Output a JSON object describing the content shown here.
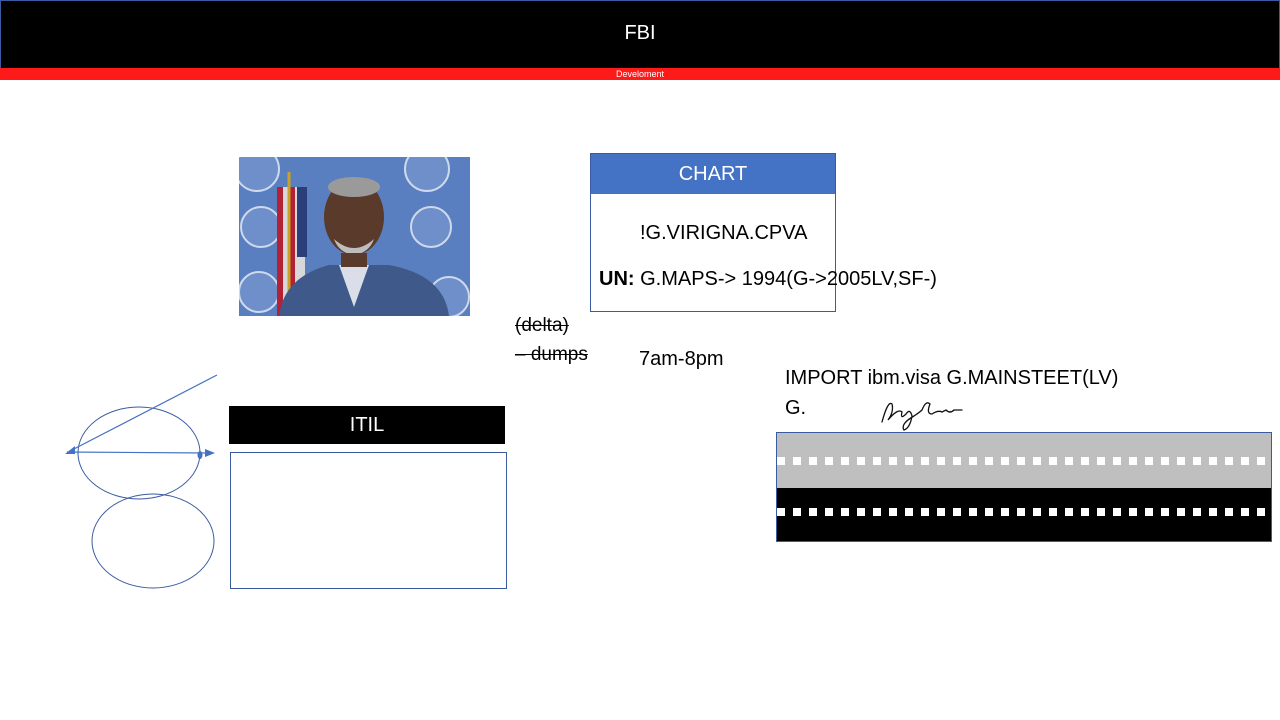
{
  "header": {
    "title": "FBI",
    "subtitle": "Develoment",
    "bar_color": "#ff1a1a",
    "background": "#000000"
  },
  "photo": {
    "icon": "portrait-photo"
  },
  "chart_box": {
    "title": "CHART",
    "line1": "!G.VIRIGNA.CPVA",
    "line2_prefix": "UN:",
    "line2_text": " G.MAPS-> 1994(G->2005LV,SF-)",
    "header_color": "#4472c4"
  },
  "notes": {
    "delta": "(delta)",
    "dumps": "– dumps",
    "hours": "7am-8pm"
  },
  "import_block": {
    "line": "IMPORT ibm.visa G.MAINSTEET(LV)",
    "g_label": "G.",
    "signature_icon": "handwritten-signature"
  },
  "itil": {
    "title": "ITIL"
  },
  "diagram": {
    "icon": "ellipse-arrow-diagram",
    "stroke_color": "#4472c4"
  }
}
